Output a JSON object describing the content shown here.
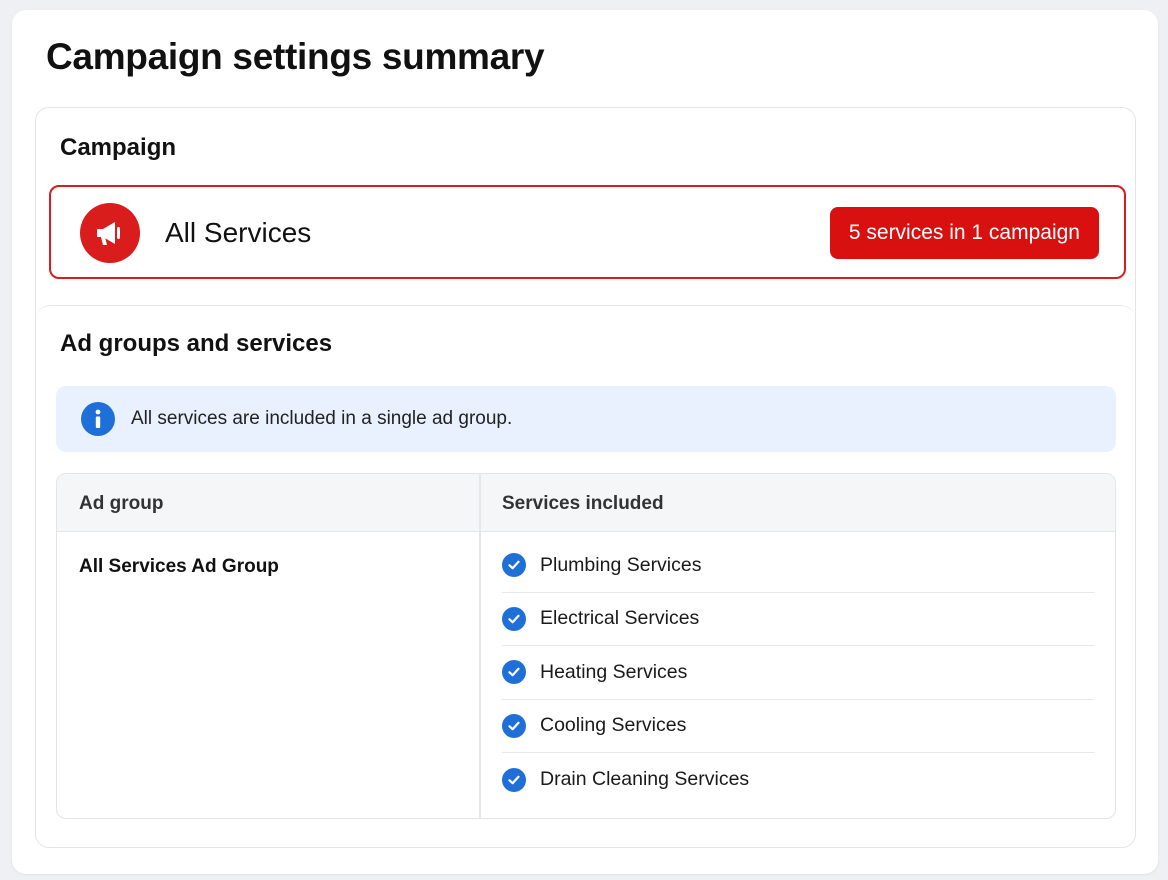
{
  "page": {
    "title": "Campaign settings summary"
  },
  "campaign": {
    "section_title": "Campaign",
    "name": "All Services",
    "badge": "5 services in 1 campaign",
    "icon": "megaphone-icon"
  },
  "ad_groups": {
    "section_title": "Ad groups and services",
    "info_message": "All services are included in a single ad group.",
    "info_icon": "info-icon",
    "table": {
      "headers": {
        "ad_group": "Ad group",
        "services_included": "Services included"
      },
      "rows": [
        {
          "ad_group": "All Services Ad Group",
          "services": [
            "Plumbing Services",
            "Electrical Services",
            "Heating Services",
            "Cooling Services",
            "Drain Cleaning Services"
          ]
        }
      ]
    }
  },
  "colors": {
    "accent_red": "#d91c1c",
    "accent_blue": "#1f6fd8",
    "info_bg": "#e8f1fd"
  }
}
